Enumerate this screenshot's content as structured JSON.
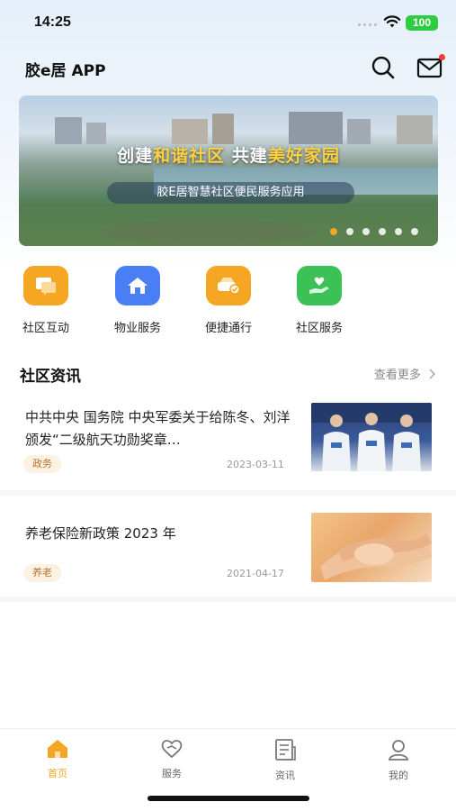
{
  "status_bar": {
    "time": "14:25",
    "battery": "100"
  },
  "header": {
    "title": "胶e居 APP"
  },
  "banner": {
    "headline_part1": "创建",
    "headline_hl1": "和谐社区",
    "headline_part2": " 共建",
    "headline_hl2": "美好家园",
    "subtitle": "胶E居智慧社区便民服务应用",
    "highlight_color": "#ffd23f",
    "slide_count": 6,
    "active_slide": 1
  },
  "quick_actions": [
    {
      "label": "社区互动",
      "icon": "chat-bubbles-icon",
      "color": "#f5a623"
    },
    {
      "label": "物业服务",
      "icon": "house-icon",
      "color": "#4a7ef5"
    },
    {
      "label": "便捷通行",
      "icon": "car-pass-icon",
      "color": "#f5a623"
    },
    {
      "label": "社区服务",
      "icon": "heart-hand-icon",
      "color": "#3cc157"
    }
  ],
  "news_section": {
    "title": "社区资讯",
    "more": "查看更多"
  },
  "news": [
    {
      "title": "中共中央 国务院 中央军委关于给陈冬、刘洋颁发“二级航天功勋奖章…",
      "tag": "政务",
      "date": "2023-03-11",
      "thumb": "astronauts-photo"
    },
    {
      "title": "养老保险新政策 2023 年",
      "tag": "养老",
      "date": "2021-04-17",
      "thumb": "holding-hands-photo"
    }
  ],
  "tabbar": {
    "tabs": [
      {
        "label": "首页",
        "icon": "home-icon",
        "active": true
      },
      {
        "label": "服务",
        "icon": "heart-service-icon",
        "active": false
      },
      {
        "label": "资讯",
        "icon": "news-icon",
        "active": false
      },
      {
        "label": "我的",
        "icon": "profile-icon",
        "active": false
      }
    ],
    "active_color": "#f5a623"
  }
}
